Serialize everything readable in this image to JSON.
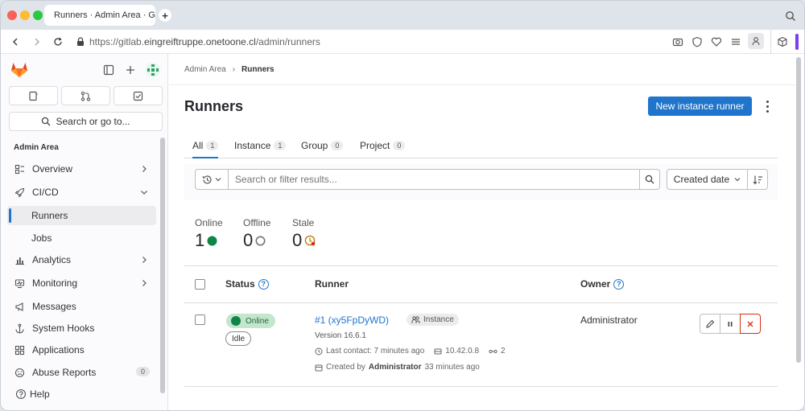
{
  "browser": {
    "tab_title": "Runners · Admin Area · G",
    "url_prefix": "https://gitlab.",
    "url_host": "eingreiftruppe.onetoone.cl",
    "url_path": "/admin/runners"
  },
  "sidebar": {
    "search_placeholder": "Search or go to...",
    "section_title": "Admin Area",
    "items": [
      {
        "label": "Overview"
      },
      {
        "label": "CI/CD"
      },
      {
        "label": "Runners"
      },
      {
        "label": "Jobs"
      },
      {
        "label": "Analytics"
      },
      {
        "label": "Monitoring"
      },
      {
        "label": "Messages"
      },
      {
        "label": "System Hooks"
      },
      {
        "label": "Applications"
      },
      {
        "label": "Abuse Reports",
        "count": "0"
      }
    ],
    "help_label": "Help"
  },
  "breadcrumb": {
    "parent": "Admin Area",
    "separator": "›",
    "current": "Runners"
  },
  "page": {
    "title": "Runners",
    "new_runner_button": "New instance runner"
  },
  "tabs": [
    {
      "label": "All",
      "count": "1"
    },
    {
      "label": "Instance",
      "count": "1"
    },
    {
      "label": "Group",
      "count": "0"
    },
    {
      "label": "Project",
      "count": "0"
    }
  ],
  "filter": {
    "placeholder": "Search or filter results...",
    "sort_label": "Created date"
  },
  "stats": {
    "online": {
      "label": "Online",
      "value": "1"
    },
    "offline": {
      "label": "Offline",
      "value": "0"
    },
    "stale": {
      "label": "Stale",
      "value": "0"
    }
  },
  "table": {
    "headers": {
      "status": "Status",
      "runner": "Runner",
      "owner": "Owner"
    },
    "rows": [
      {
        "status": "Online",
        "substatus": "Idle",
        "runner_name": "#1 (xy5FpDyWD)",
        "type_badge": "Instance",
        "version": "Version 16.6.1",
        "last_contact": "Last contact: 7 minutes ago",
        "ip": "10.42.0.8",
        "jobs": "2",
        "created_prefix": "Created by",
        "created_by": "Administrator",
        "created_ago": "33 minutes ago",
        "owner": "Administrator"
      }
    ]
  },
  "colors": {
    "primary": "#1f75cb",
    "online": "#108548",
    "danger": "#dd2b0e",
    "stale": "#c17d10"
  }
}
